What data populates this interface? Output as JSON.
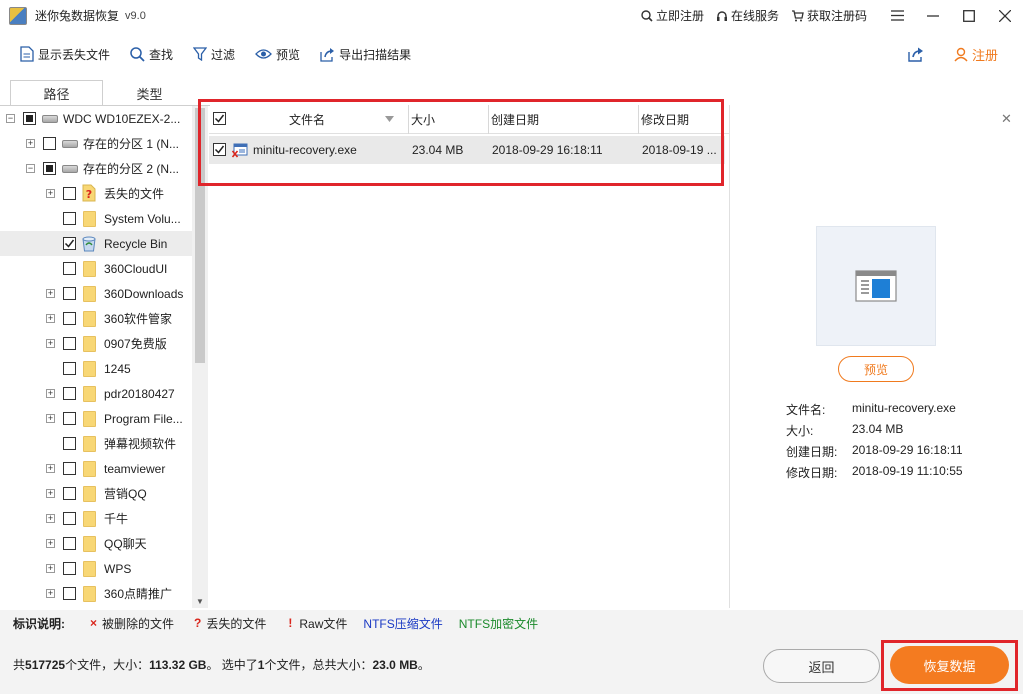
{
  "app": {
    "title": "迷你兔数据恢复",
    "version": "v9.0",
    "links": [
      "立即注册",
      "在线服务",
      "获取注册码"
    ]
  },
  "toolbar": {
    "show_lost": "显示丢失文件",
    "find": "查找",
    "filter": "过滤",
    "preview": "预览",
    "export": "导出扫描结果",
    "register": "注册"
  },
  "tabs": [
    "路径",
    "类型"
  ],
  "tree": {
    "disk": "WDC WD10EZEX-2...",
    "partitions": [
      "存在的分区 1 (N...",
      "存在的分区 2 (N..."
    ],
    "items": [
      {
        "label": "丢失的文件",
        "icon": "lost-file-icon"
      },
      {
        "label": "System Volu...",
        "icon": "folder-icon"
      },
      {
        "label": "Recycle Bin",
        "icon": "recycle-bin-icon",
        "checked": true
      },
      {
        "label": "360CloudUI",
        "icon": "folder-icon"
      },
      {
        "label": "360Downloads",
        "icon": "folder-icon"
      },
      {
        "label": "360软件管家",
        "icon": "folder-icon"
      },
      {
        "label": "0907免费版",
        "icon": "folder-icon"
      },
      {
        "label": "1245",
        "icon": "folder-icon"
      },
      {
        "label": "pdr20180427",
        "icon": "folder-icon"
      },
      {
        "label": "Program File...",
        "icon": "folder-icon"
      },
      {
        "label": "弹幕视频软件",
        "icon": "folder-icon"
      },
      {
        "label": "teamviewer",
        "icon": "folder-icon"
      },
      {
        "label": "营销QQ",
        "icon": "folder-icon"
      },
      {
        "label": "千牛",
        "icon": "folder-icon"
      },
      {
        "label": "QQ聊天",
        "icon": "folder-icon"
      },
      {
        "label": "WPS",
        "icon": "folder-icon"
      },
      {
        "label": "360点睛推广",
        "icon": "folder-icon"
      }
    ]
  },
  "file_table": {
    "headers": [
      "文件名",
      "大小",
      "创建日期",
      "修改日期"
    ],
    "rows": [
      {
        "name": "minitu-recovery.exe",
        "size": "23.04 MB",
        "created": "2018-09-29 16:18:11",
        "modified": "2018-09-19 ..."
      }
    ]
  },
  "preview": {
    "button": "预览",
    "labels": [
      "文件名:",
      "大小:",
      "创建日期:",
      "修改日期:"
    ],
    "values": [
      "minitu-recovery.exe",
      "23.04 MB",
      "2018-09-29 16:18:11",
      "2018-09-19 11:10:55"
    ]
  },
  "legend": {
    "title": "标识说明:",
    "deleted": "被删除的文件",
    "lost": "丢失的文件",
    "raw": "Raw文件",
    "ntfs_compressed": "NTFS压缩文件",
    "ntfs_encrypted": "NTFS加密文件",
    "colors": {
      "deleted": "#d9261c",
      "ntfs_compressed": "#1a39c4",
      "ntfs_encrypted": "#1b8a2b"
    }
  },
  "status": {
    "p1": "共",
    "total_files": "517725",
    "p2": "个文件，大小：",
    "total_size": "113.32 GB",
    "p3": "。 选中了",
    "selected_count": "1",
    "p4": "个文件，总共大小：",
    "selected_size": "23.0 MB",
    "p5": "。"
  },
  "buttons": {
    "back": "返回",
    "recover": "恢复数据"
  },
  "colors": {
    "accent": "#f47b20",
    "highlight": "#e0252b"
  }
}
